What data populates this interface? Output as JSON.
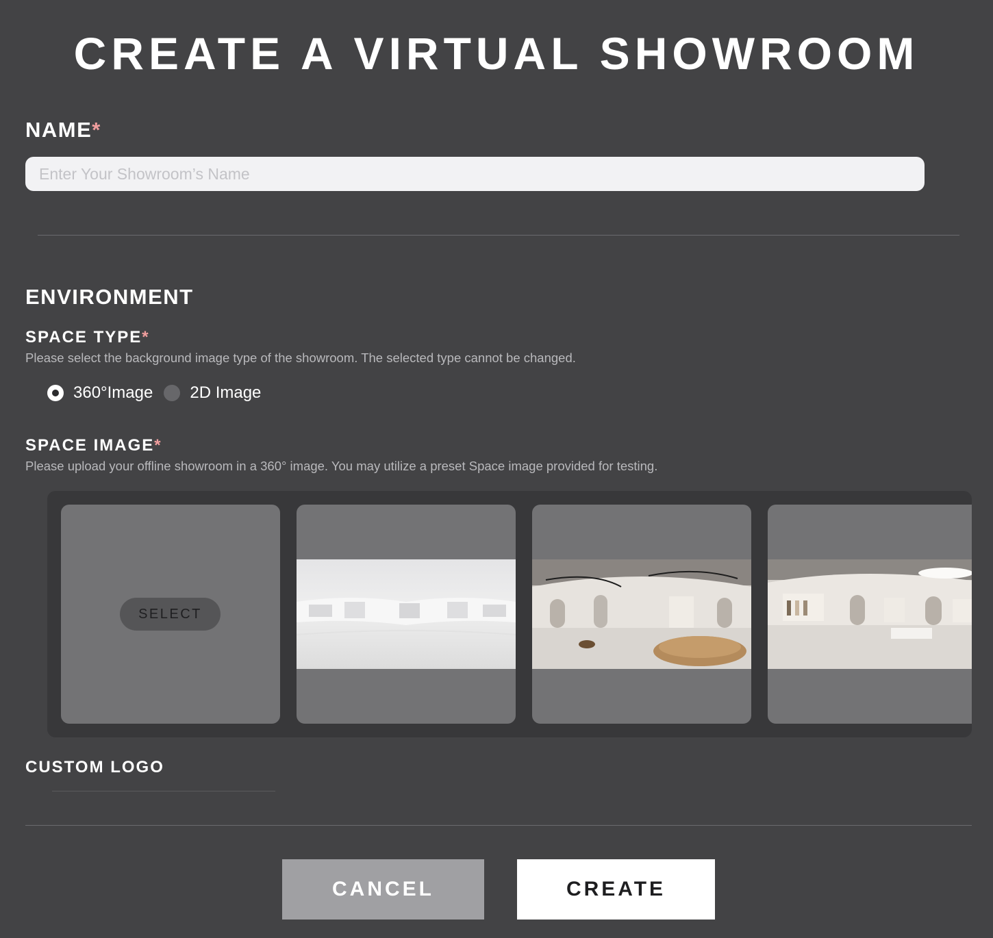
{
  "page": {
    "title": "CREATE A VIRTUAL SHOWROOM"
  },
  "name_section": {
    "label": "NAME",
    "required_mark": "*",
    "input_placeholder": "Enter Your Showroom’s Name",
    "input_value": ""
  },
  "environment": {
    "heading": "ENVIRONMENT",
    "space_type": {
      "label": "SPACE TYPE",
      "required_mark": "*",
      "description": "Please select the background image type of the showroom. The selected type cannot be changed.",
      "options": [
        {
          "label": "360°Image",
          "selected": true
        },
        {
          "label": "2D Image",
          "selected": false
        }
      ]
    },
    "space_image": {
      "label": "SPACE IMAGE",
      "required_mark": "*",
      "description": "Please upload your offline showroom in a 360° image. You may utilize a preset Space image provided for testing.",
      "select_button_label": "SELECT",
      "presets": [
        "white-empty-showroom",
        "showroom-wooden-stage",
        "boutique-showroom"
      ]
    },
    "custom_logo": {
      "label": "CUSTOM LOGO"
    }
  },
  "actions": {
    "cancel_label": "CANCEL",
    "create_label": "CREATE"
  },
  "colors": {
    "background": "#434345",
    "required_asterisk": "#f19e9e",
    "input_background": "#f2f2f4",
    "gallery_background": "#38383a",
    "tile_background": "#737375",
    "cancel_button": "#a0a0a3",
    "create_button": "#ffffff"
  }
}
